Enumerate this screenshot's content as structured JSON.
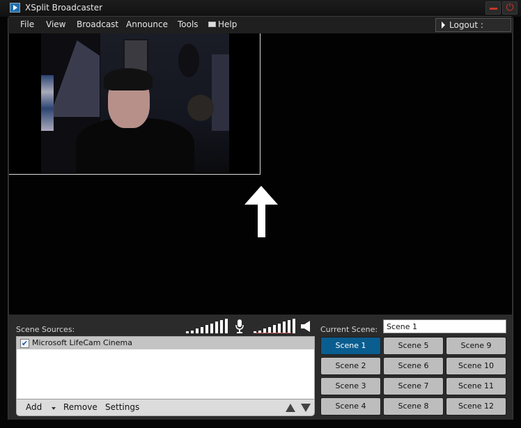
{
  "window": {
    "title": "XSplit Broadcaster",
    "icons": {
      "app": "xsplit-logo-icon",
      "minimize": "minimize-icon",
      "power": "power-icon"
    }
  },
  "menu": {
    "items": [
      "File",
      "View",
      "Broadcast",
      "Announce",
      "Tools",
      "Help"
    ],
    "help_icon": "mail-icon",
    "logout_label": "Logout :"
  },
  "preview": {
    "source": "webcam-feed",
    "annotation_icon": "up-arrow-icon"
  },
  "audio": {
    "mic_level": 1.0,
    "speaker_level": 1.0,
    "mic_icon": "microphone-icon",
    "speaker_icon": "speaker-icon",
    "accent_color": "#e06b6b"
  },
  "sources": {
    "label": "Scene Sources:",
    "items": [
      {
        "name": "Microsoft LifeCam Cinema",
        "checked": true
      }
    ],
    "toolbar": {
      "add": "Add",
      "remove": "Remove",
      "settings": "Settings"
    }
  },
  "scenes": {
    "label": "Current Scene:",
    "current": "Scene 1",
    "active_color": "#0a5d8f",
    "buttons": [
      "Scene 1",
      "Scene 2",
      "Scene 3",
      "Scene 4",
      "Scene 5",
      "Scene 6",
      "Scene 7",
      "Scene 8",
      "Scene 9",
      "Scene 10",
      "Scene 11",
      "Scene 12"
    ]
  }
}
